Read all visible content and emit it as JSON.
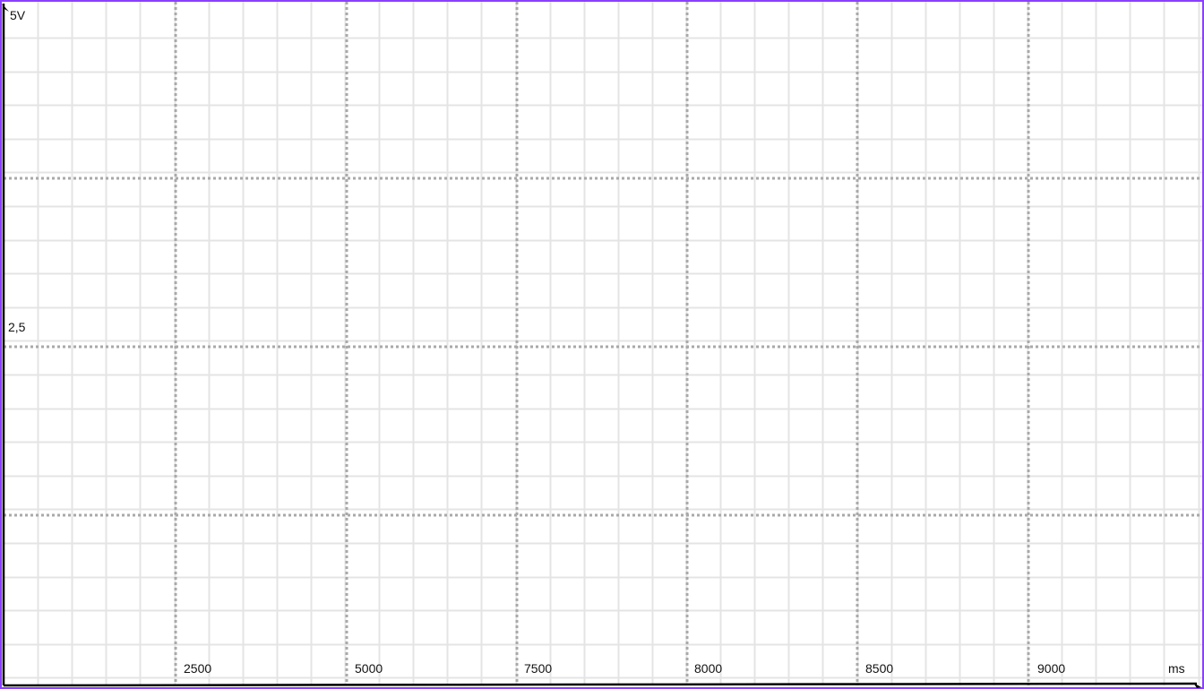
{
  "scope": {
    "y_labels": [
      {
        "text": "5V",
        "value": 5
      },
      {
        "text": "2,5",
        "value": 2.5
      }
    ],
    "x_labels": [
      "2500",
      "5000",
      "7500",
      "8000",
      "8500",
      "9000"
    ],
    "x_unit": "ms",
    "colors": {
      "frame": "#8a3ffc",
      "axis": "#000000",
      "major_grid": "#a9a9a9",
      "minor_grid": "#e4e4e4",
      "background": "#ffffff"
    }
  }
}
